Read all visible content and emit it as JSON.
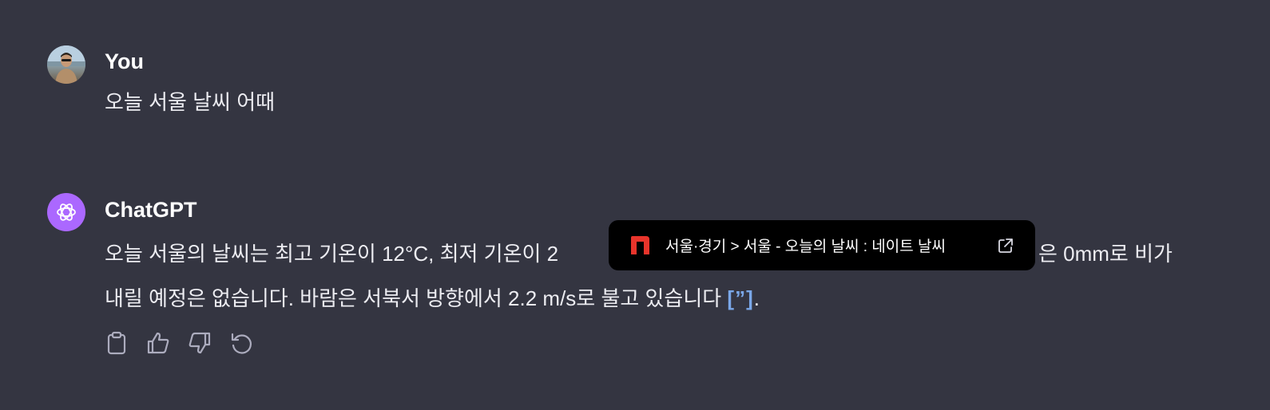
{
  "conversation": {
    "user": {
      "name": "You",
      "message": "오늘 서울 날씨 어때"
    },
    "assistant": {
      "name": "ChatGPT",
      "line1": "오늘 서울의 날씨는 최고 기온이 12°C, 최저 기온이 2",
      "line1_end": "은 0mm로 비가",
      "line2": "내릴 예정은 없습니다. 바람은 서북서 방향에서 2.2 m/s로 불고 있습니다",
      "citation": "[”]",
      "end_punct": "."
    }
  },
  "tooltip": {
    "text": "서울·경기 > 서울 - 오늘의 날씨 : 네이트 날씨",
    "logo": "nate-logo",
    "icon": "external-link-icon"
  },
  "actions": [
    {
      "icon": "clipboard-icon"
    },
    {
      "icon": "thumbs-up-icon"
    },
    {
      "icon": "thumbs-down-icon"
    },
    {
      "icon": "regenerate-icon"
    }
  ],
  "colors": {
    "background": "#343541",
    "assistant_avatar": "#ab68ff",
    "citation": "#7aa7e8",
    "tooltip_bg": "#000000",
    "nate_red": "#e8342b"
  }
}
